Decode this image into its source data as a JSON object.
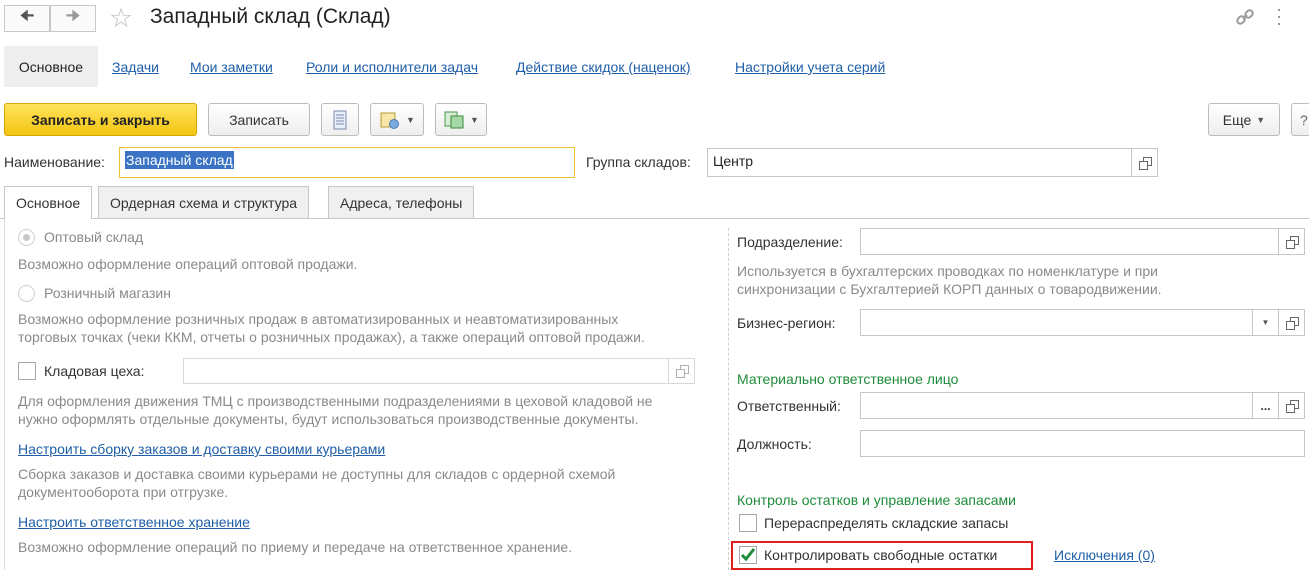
{
  "window": {
    "title": "Западный склад (Склад)"
  },
  "top_tabs": [
    {
      "label": "Основное",
      "active": true
    },
    {
      "label": "Задачи"
    },
    {
      "label": "Мои заметки"
    },
    {
      "label": "Роли и исполнители задач"
    },
    {
      "label": "Действие скидок (наценок)"
    },
    {
      "label": "Настройки учета серий"
    }
  ],
  "toolbar": {
    "save_close_label": "Записать и закрыть",
    "save_label": "Записать",
    "more_label": "Еще"
  },
  "header_fields": {
    "name_label": "Наименование:",
    "name_value": "Западный склад",
    "group_label": "Группа складов:",
    "group_value": "Центр"
  },
  "form_tabs": [
    {
      "label": "Основное",
      "active": true
    },
    {
      "label": "Ордерная схема и структура"
    },
    {
      "label": "Адреса, телефоны"
    }
  ],
  "left": {
    "wholesale_label": "Оптовый склад",
    "wholesale_selected": true,
    "wholesale_desc": "Возможно оформление операций оптовой продажи.",
    "retail_label": "Розничный магазин",
    "retail_desc_1": "Возможно оформление розничных продаж в автоматизированных и неавтоматизированных",
    "retail_desc_2": "торговых точках (чеки ККМ, отчеты о розничных продажах), а также операций оптовой продажи.",
    "shop_store_label": "Кладовая цеха:",
    "shop_store_value": "",
    "shop_store_desc_1": "Для оформления движения ТМЦ с производственными подразделениями в цеховой кладовой не",
    "shop_store_desc_2": "нужно оформлять отдельные документы, будут использоваться производственные документы.",
    "setup_delivery_link": "Настроить сборку заказов и доставку своими курьерами",
    "setup_delivery_desc_1": "Сборка заказов и доставка своими курьерами не доступны для складов с ордерной схемой",
    "setup_delivery_desc_2": "документооборота при отгрузке.",
    "setup_storage_link": "Настроить ответственное хранение",
    "setup_storage_desc": "Возможно оформление операций по приему и передаче на ответственное хранение."
  },
  "right": {
    "department_label": "Подразделение:",
    "department_value": "",
    "department_desc_1": "Используется в бухгалтерских проводках по номенклатуре и при",
    "department_desc_2": "синхронизации с Бухгалтерией КОРП данных о товародвижении.",
    "region_label": "Бизнес-регион:",
    "region_value": "",
    "mol_section": "Материально ответственное лицо",
    "responsible_label": "Ответственный:",
    "responsible_value": "",
    "position_label": "Должность:",
    "position_value": "",
    "stock_section": "Контроль остатков и управление запасами",
    "redistribute_label": "Перераспределять складские запасы",
    "redistribute_checked": false,
    "control_label": "Контролировать свободные остатки",
    "control_checked": true,
    "exceptions_link": "Исключения (0)"
  },
  "colors": {
    "accent_yellow": "#f3c512",
    "link_blue": "#1f5fa8",
    "section_green": "#1e8c3a",
    "highlight_red": "#e02020",
    "selection_blue": "#3a73c4"
  }
}
